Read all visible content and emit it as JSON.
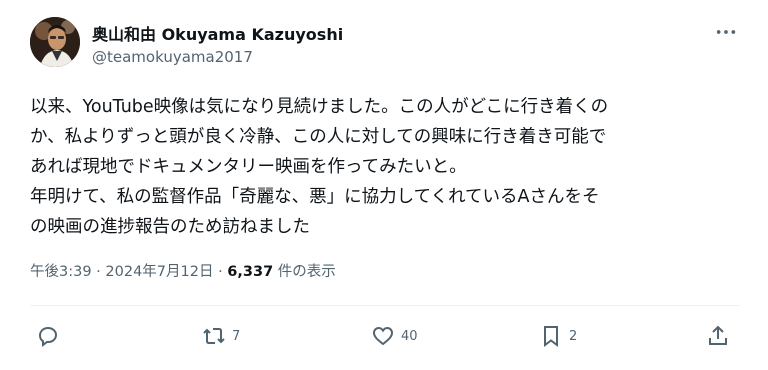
{
  "author": {
    "display_name": "奥山和由 Okuyama Kazuyoshi",
    "handle": "@teamokuyama2017"
  },
  "body": {
    "lines": [
      "以来、YouTube映像は気になり見続けました。この人がどこに行き着くの",
      "か、私よりずっと頭が良く冷静、この人に対しての興味に行き着き可能で",
      "あれば現地でドキュメンタリー映画を作ってみたいと。",
      "年明けて、私の監督作品「奇麗な、悪」に協力してくれているAさんをそ",
      "の映画の進捗報告のため訪ねました"
    ]
  },
  "meta": {
    "time": "午後3:39",
    "separator1": " · ",
    "date": "2024年7月12日",
    "separator2": " · ",
    "views_count": "6,337",
    "views_label": " 件の表示"
  },
  "actions": {
    "reply_count": "",
    "retweet_count": "7",
    "like_count": "40",
    "bookmark_count": "2"
  },
  "icons": {
    "more": "more-icon",
    "reply": "reply-icon",
    "retweet": "retweet-icon",
    "like": "heart-icon",
    "bookmark": "bookmark-icon",
    "share": "share-icon"
  }
}
